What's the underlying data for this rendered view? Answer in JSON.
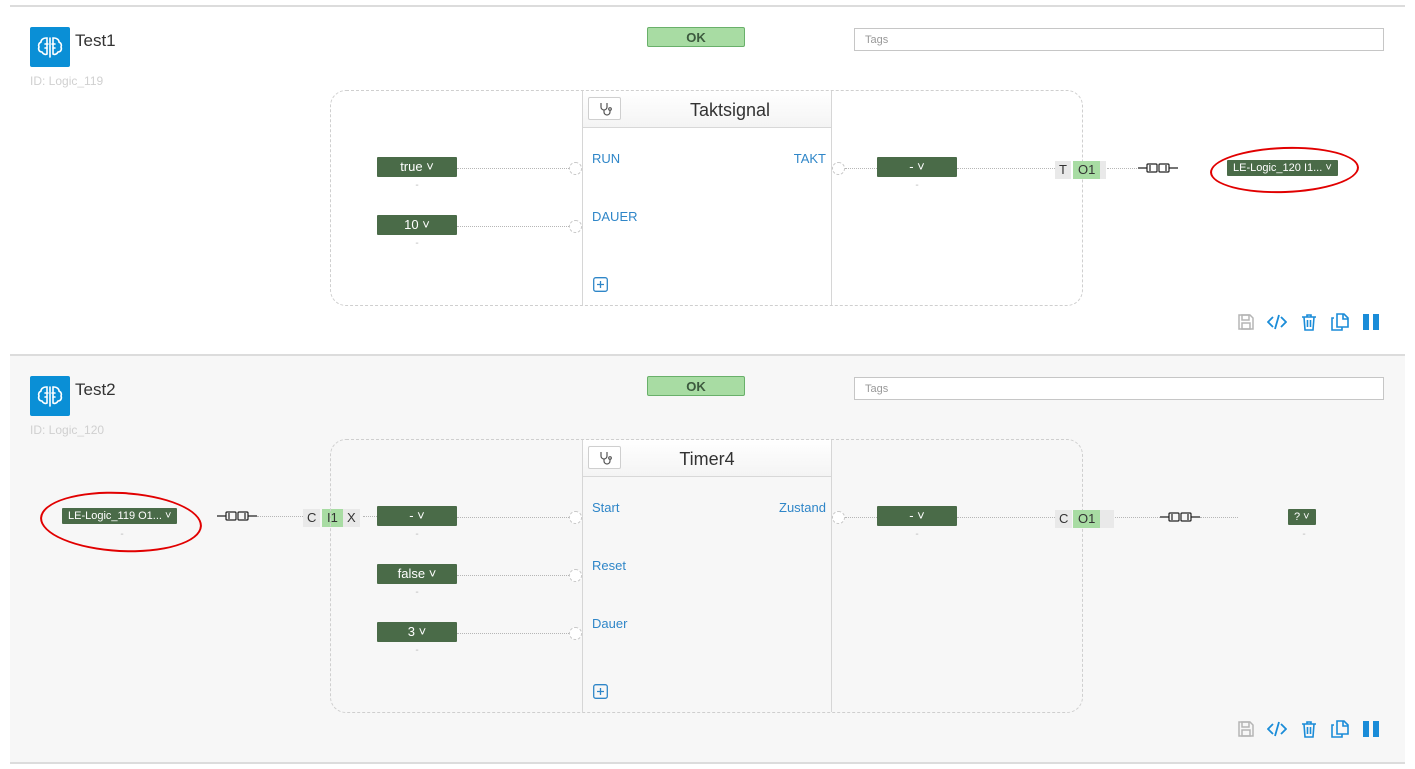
{
  "colors": {
    "accent": "#0a8fd6",
    "ok_bg": "#a8dca3",
    "value_bg": "#4a6b48",
    "pin_text": "#2f86c8",
    "annotation": "#e10000"
  },
  "logics": [
    {
      "title": "Test1",
      "id_label": "ID: Logic_119",
      "status": "OK",
      "tags_placeholder": "Tags",
      "block": {
        "name": "Taktsignal",
        "inputs": [
          {
            "pin": "RUN",
            "value": "true ˅",
            "sub": "-"
          },
          {
            "pin": "DAUER",
            "value": "10 ˅",
            "sub": "-"
          }
        ],
        "outputs": [
          {
            "pin": "TAKT",
            "value": "- ˅",
            "sub": "-"
          }
        ]
      },
      "output_connector": {
        "type_letter": "T",
        "port": "O1"
      },
      "output_target": {
        "value": "LE-Logic_120 I1... ˅"
      }
    },
    {
      "title": "Test2",
      "id_label": "ID: Logic_120",
      "status": "OK",
      "tags_placeholder": "Tags",
      "input_source": {
        "value": "LE-Logic_119 O1... ˅",
        "sub": "-"
      },
      "input_connector": {
        "type_letter": "C",
        "port": "I1",
        "close": "X"
      },
      "block": {
        "name": "Timer4",
        "inputs": [
          {
            "pin": "Start",
            "value": "- ˅",
            "sub": "-"
          },
          {
            "pin": "Reset",
            "value": "false ˅",
            "sub": "-"
          },
          {
            "pin": "Dauer",
            "value": "3 ˅",
            "sub": "-"
          }
        ],
        "outputs": [
          {
            "pin": "Zustand",
            "value": "- ˅",
            "sub": "-"
          }
        ]
      },
      "output_connector": {
        "type_letter": "C",
        "port": "O1"
      },
      "output_target": {
        "value": "? ˅",
        "sub": "-"
      }
    }
  ]
}
